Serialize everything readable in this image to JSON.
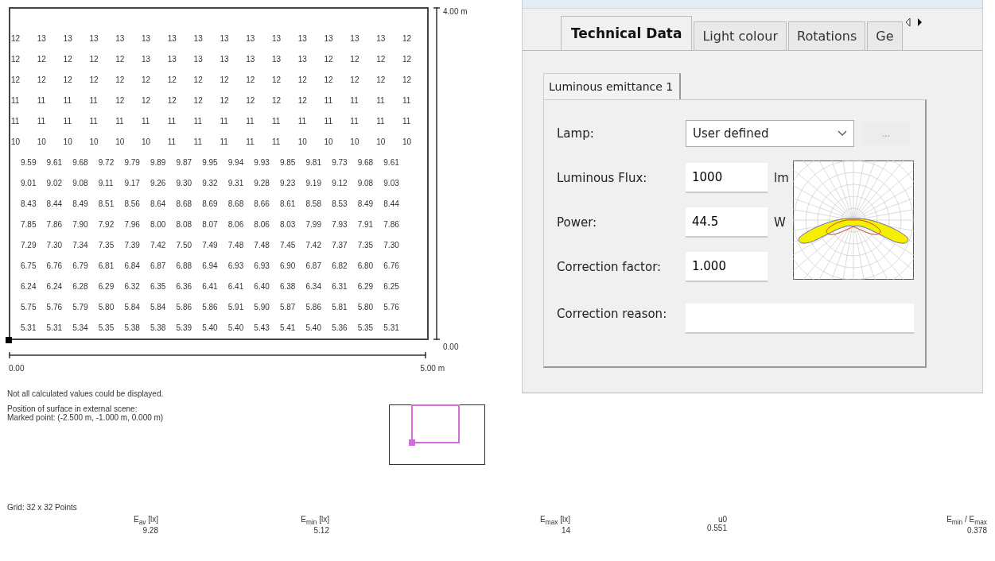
{
  "isolux_grid": {
    "rows": [
      {
        "kind": "integer",
        "values": [
          "12",
          "13",
          "13",
          "13",
          "13",
          "13",
          "13",
          "13",
          "13",
          "13",
          "13",
          "13",
          "13",
          "13",
          "13",
          "12"
        ]
      },
      {
        "kind": "integer",
        "values": [
          "12",
          "12",
          "12",
          "12",
          "12",
          "13",
          "13",
          "13",
          "13",
          "13",
          "13",
          "13",
          "12",
          "12",
          "12",
          "12"
        ]
      },
      {
        "kind": "integer",
        "values": [
          "12",
          "12",
          "12",
          "12",
          "12",
          "12",
          "12",
          "12",
          "12",
          "12",
          "12",
          "12",
          "12",
          "12",
          "12",
          "12"
        ]
      },
      {
        "kind": "integer",
        "values": [
          "11",
          "11",
          "11",
          "11",
          "12",
          "12",
          "12",
          "12",
          "12",
          "12",
          "12",
          "12",
          "11",
          "11",
          "11",
          "11"
        ]
      },
      {
        "kind": "integer",
        "values": [
          "11",
          "11",
          "11",
          "11",
          "11",
          "11",
          "11",
          "11",
          "11",
          "11",
          "11",
          "11",
          "11",
          "11",
          "11",
          "11"
        ]
      },
      {
        "kind": "integer",
        "values": [
          "10",
          "10",
          "10",
          "10",
          "10",
          "10",
          "11",
          "11",
          "11",
          "11",
          "11",
          "10",
          "10",
          "10",
          "10",
          "10"
        ]
      },
      {
        "kind": "decimal",
        "values": [
          "9.59",
          "9.61",
          "9.68",
          "9.72",
          "9.79",
          "9.89",
          "9.87",
          "9.95",
          "9.94",
          "9.93",
          "9.85",
          "9.81",
          "9.73",
          "9.68",
          "9.61"
        ]
      },
      {
        "kind": "decimal",
        "values": [
          "9.01",
          "9.02",
          "9.08",
          "9.11",
          "9.17",
          "9.26",
          "9.30",
          "9.32",
          "9.31",
          "9.28",
          "9.23",
          "9.19",
          "9.12",
          "9.08",
          "9.03"
        ]
      },
      {
        "kind": "decimal",
        "values": [
          "8.43",
          "8.44",
          "8.49",
          "8.51",
          "8.56",
          "8.64",
          "8.68",
          "8.69",
          "8.68",
          "8.66",
          "8.61",
          "8.58",
          "8.53",
          "8.49",
          "8.44"
        ]
      },
      {
        "kind": "decimal",
        "values": [
          "7.85",
          "7.86",
          "7.90",
          "7.92",
          "7.96",
          "8.00",
          "8.08",
          "8.07",
          "8.06",
          "8.06",
          "8.03",
          "7.99",
          "7.93",
          "7.91",
          "7.86"
        ]
      },
      {
        "kind": "decimal",
        "values": [
          "7.29",
          "7.30",
          "7.34",
          "7.35",
          "7.39",
          "7.42",
          "7.50",
          "7.49",
          "7.48",
          "7.48",
          "7.45",
          "7.42",
          "7.37",
          "7.35",
          "7.30"
        ]
      },
      {
        "kind": "decimal",
        "values": [
          "6.75",
          "6.76",
          "6.79",
          "6.81",
          "6.84",
          "6.87",
          "6.88",
          "6.94",
          "6.93",
          "6.93",
          "6.90",
          "6.87",
          "6.82",
          "6.80",
          "6.76"
        ]
      },
      {
        "kind": "decimal",
        "values": [
          "6.24",
          "6.24",
          "6.28",
          "6.29",
          "6.32",
          "6.35",
          "6.36",
          "6.41",
          "6.41",
          "6.40",
          "6.38",
          "6.34",
          "6.31",
          "6.29",
          "6.25"
        ]
      },
      {
        "kind": "decimal",
        "values": [
          "5.75",
          "5.76",
          "5.79",
          "5.80",
          "5.84",
          "5.84",
          "5.86",
          "5.86",
          "5.91",
          "5.90",
          "5.87",
          "5.86",
          "5.81",
          "5.80",
          "5.76"
        ]
      },
      {
        "kind": "decimal",
        "values": [
          "5.31",
          "5.31",
          "5.34",
          "5.35",
          "5.38",
          "5.38",
          "5.39",
          "5.40",
          "5.40",
          "5.43",
          "5.41",
          "5.40",
          "5.36",
          "5.35",
          "5.31"
        ]
      }
    ],
    "y_top_label": "4.00 m",
    "y_bottom_label": "0.00",
    "x_start_label": "0.00",
    "x_end_label": "5.00 m"
  },
  "note": "Not all calculated values could be displayed.",
  "position": {
    "title": "Position of surface in external scene:",
    "marked_point": "Marked point: (-2.500 m, -1.000 m, 0.000 m)"
  },
  "grid_info": "Grid: 32 x 32 Points",
  "summary": [
    {
      "label": "E$_{av}$ [lx]",
      "value": "9.28"
    },
    {
      "label": "E$_{min}$ [lx]",
      "value": "5.12"
    },
    {
      "label": "E$_{max}$ [lx]",
      "value": "14"
    },
    {
      "label": "u0",
      "value": "0.551"
    },
    {
      "label": "E$_{min}$ / E$_{max}$",
      "value": "0.378"
    }
  ],
  "luminaire_panel": {
    "tabs": [
      {
        "label": "Technical Data",
        "selected": true
      },
      {
        "label": "Light colour",
        "selected": false
      },
      {
        "label": "Rotations",
        "selected": false
      },
      {
        "label": "Ge",
        "selected": false
      }
    ],
    "sub_tabs": [
      {
        "label": "Luminous emittance 1",
        "selected": true
      }
    ],
    "fields": [
      {
        "kind": "dropdown",
        "label": "Lamp:",
        "value": "User defined",
        "button": "..."
      },
      {
        "kind": "input",
        "label": "Luminous Flux:",
        "value": "1000",
        "unit": "lm"
      },
      {
        "kind": "input",
        "label": "Power:",
        "value": "44.5",
        "unit": "W"
      },
      {
        "kind": "input",
        "label": "Correction factor:",
        "value": "1.000"
      },
      {
        "kind": "wide-input",
        "label": "Correction reason:"
      }
    ]
  }
}
